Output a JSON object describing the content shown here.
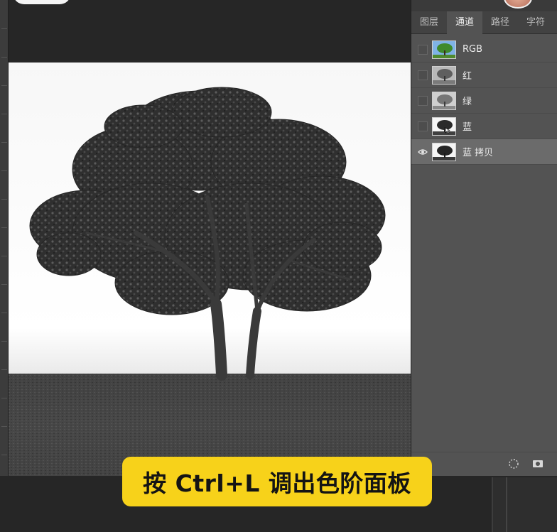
{
  "panel": {
    "tabs": [
      {
        "label": "图层",
        "active": false
      },
      {
        "label": "通道",
        "active": true
      },
      {
        "label": "路径",
        "active": false
      },
      {
        "label": "字符",
        "active": false
      }
    ],
    "channels": [
      {
        "label": "RGB",
        "thumb": "color-tree-thumbnail",
        "visible": false,
        "selected": false
      },
      {
        "label": "红",
        "thumb": "gray-tree-thumbnail",
        "visible": false,
        "selected": false
      },
      {
        "label": "绿",
        "thumb": "gray-tree-thumbnail",
        "visible": false,
        "selected": false
      },
      {
        "label": "蓝",
        "thumb": "dark-tree-thumbnail",
        "visible": false,
        "selected": false
      },
      {
        "label": "蓝 拷贝",
        "thumb": "dark-tree-thumbnail",
        "visible": true,
        "selected": true
      }
    ],
    "footer_icons": [
      "dotted-circle-selection-icon",
      "channel-mask-icon"
    ]
  },
  "canvas": {
    "content": "black-and-white-tree-photo"
  },
  "caption": {
    "text": "按 Ctrl+L 调出色阶面板"
  },
  "colors": {
    "panel_bg": "#535353",
    "selected_row": "#6b6b6b",
    "caption_bg": "#f7d21a",
    "workspace": "#262626"
  }
}
